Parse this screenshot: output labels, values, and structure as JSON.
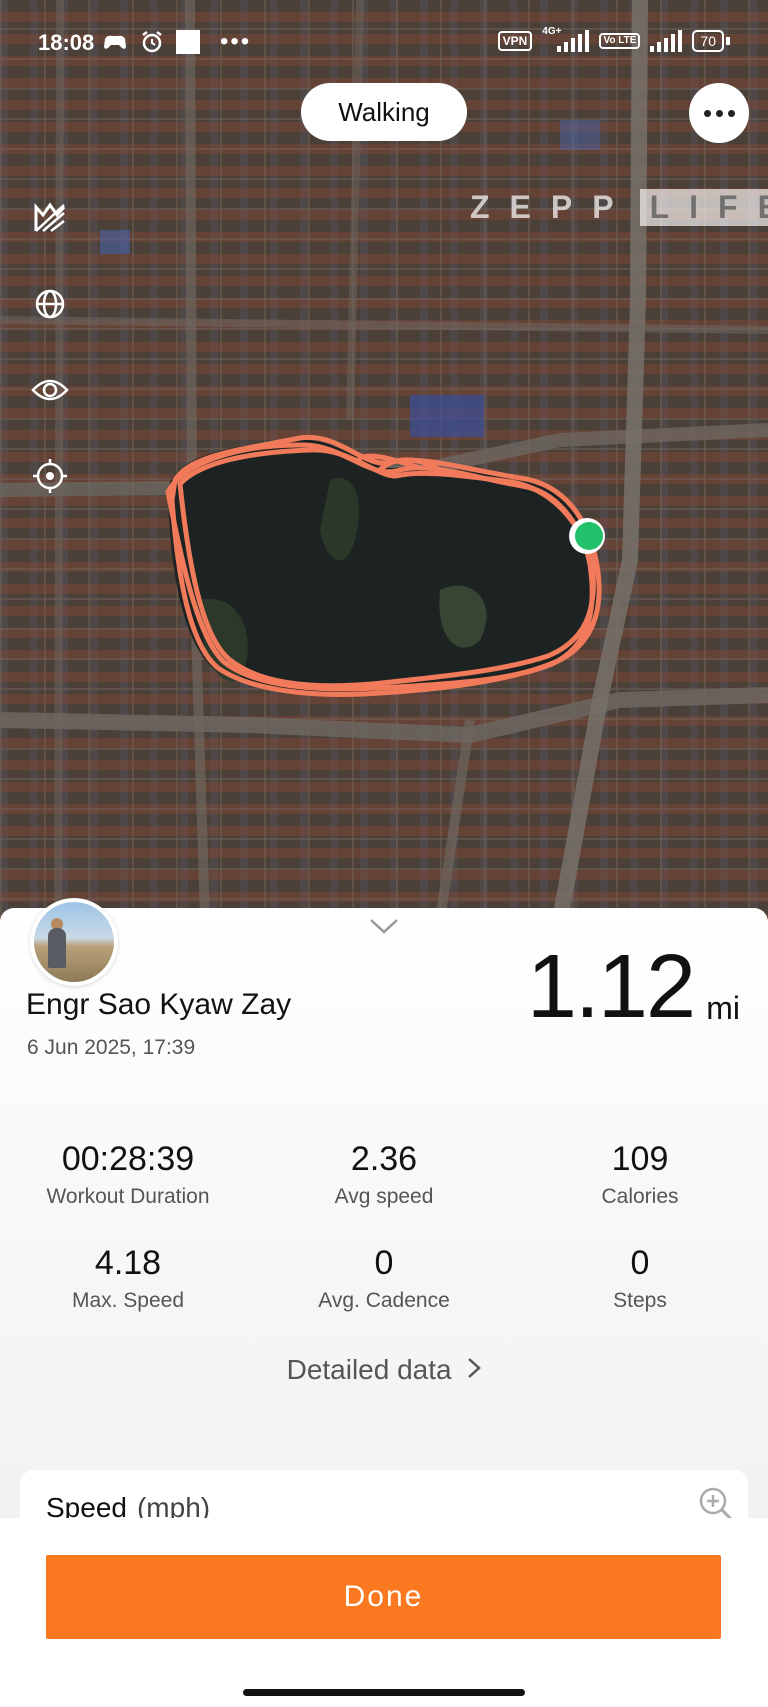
{
  "status_bar": {
    "time": "18:08",
    "vpn": "VPN",
    "network": "4G+",
    "volte": "Vo LTE",
    "battery": "70"
  },
  "map": {
    "activity_type": "Walking",
    "logo_left": "ZEPP",
    "logo_right": "LIFE",
    "route_color": "#f07a5a",
    "current_position_color": "#22c06a"
  },
  "workout": {
    "user_name": "Engr Sao Kyaw Zay",
    "date": "6 Jun 2025, 17:39",
    "distance": "1.12",
    "distance_unit": "mi",
    "stats": [
      {
        "value": "00:28:39",
        "label": "Workout Duration"
      },
      {
        "value": "2.36",
        "label": "Avg speed"
      },
      {
        "value": "109",
        "label": "Calories"
      },
      {
        "value": "4.18",
        "label": "Max. Speed"
      },
      {
        "value": "0",
        "label": "Avg. Cadence"
      },
      {
        "value": "0",
        "label": "Steps"
      }
    ],
    "detailed_link": "Detailed data"
  },
  "speed_card": {
    "title": "Speed",
    "unit": "(mph)"
  },
  "done_label": "Done",
  "colors": {
    "accent": "#fa7820"
  }
}
